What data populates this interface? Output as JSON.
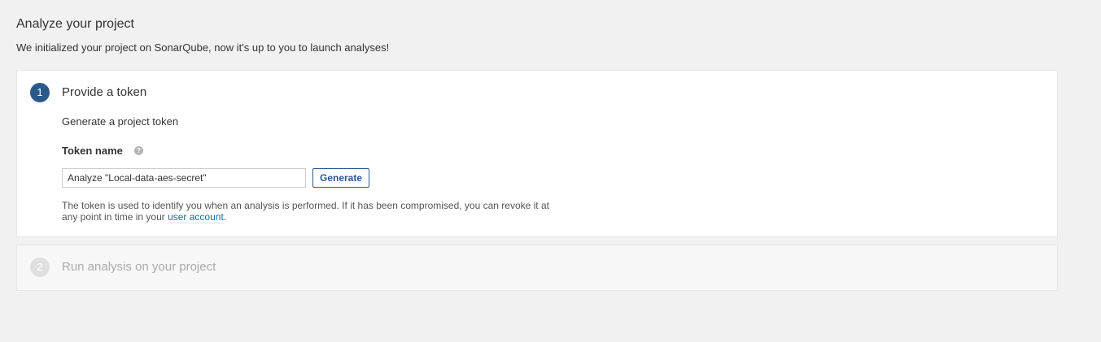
{
  "header": {
    "title": "Analyze your project",
    "description": "We initialized your project on SonarQube, now it's up to you to launch analyses!"
  },
  "steps": [
    {
      "number": "1",
      "title": "Provide a token",
      "subtitle": "Generate a project token",
      "token": {
        "label": "Token name",
        "help_icon": "question-circle-icon",
        "value": "Analyze \"Local-data-aes-secret\"",
        "generate_label": "Generate",
        "note_before_link": "The token is used to identify you when an analysis is performed. If it has been compromised, you can revoke it at any point in time in your ",
        "note_link": "user account",
        "note_after_link": "."
      }
    },
    {
      "number": "2",
      "title": "Run analysis on your project"
    }
  ],
  "colors": {
    "accent": "#2b5a8a",
    "link": "#236a97",
    "page_background": "#f1f1f1",
    "inactive_text": "#aaaaaa"
  }
}
